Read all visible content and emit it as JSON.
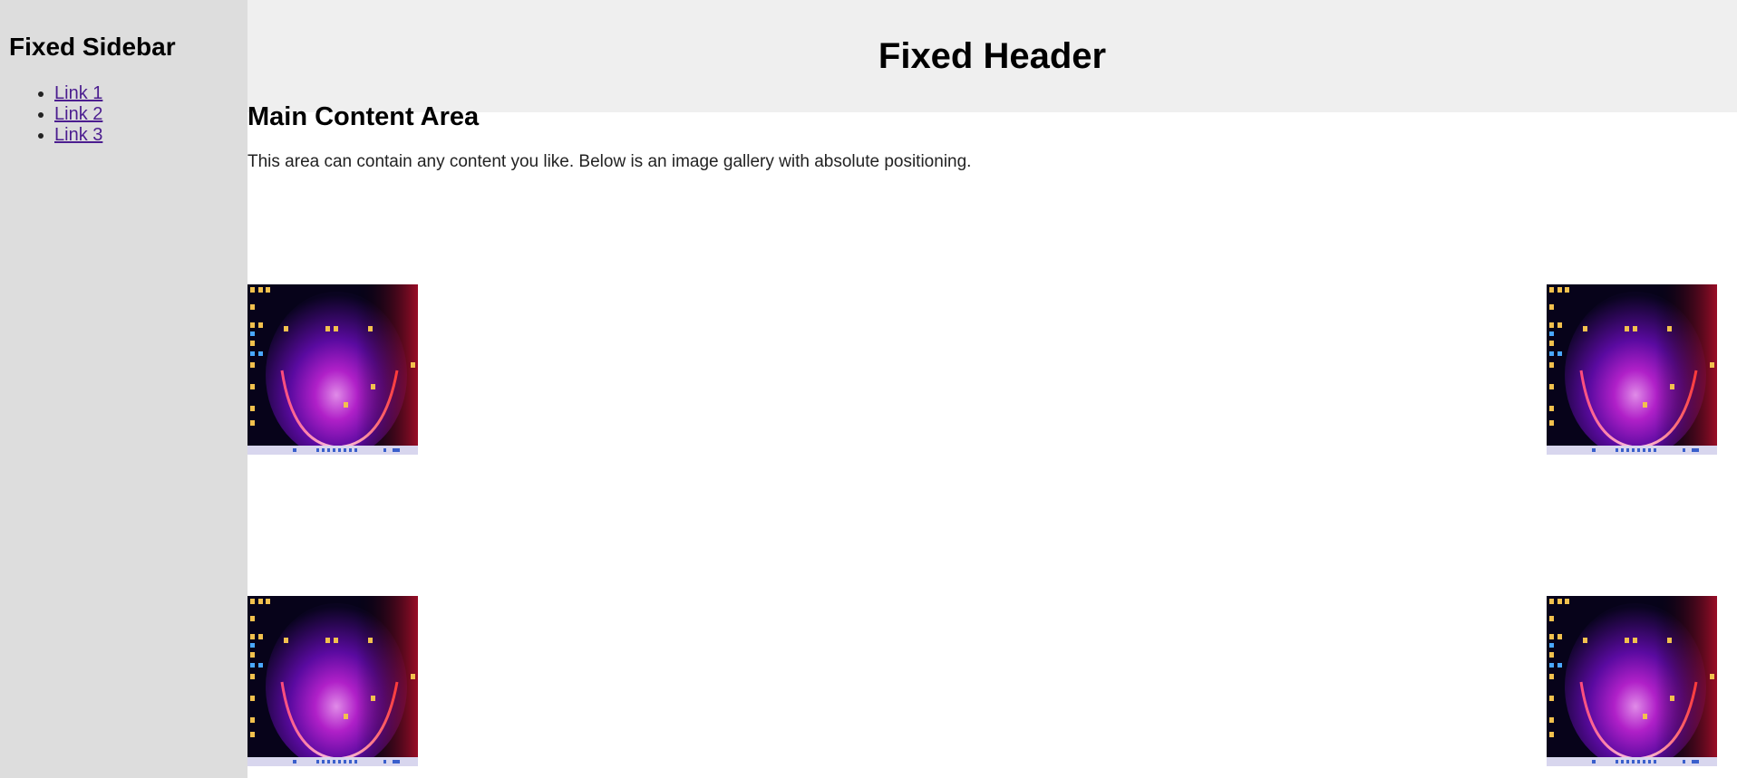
{
  "sidebar": {
    "title": "Fixed Sidebar",
    "links": [
      "Link 1",
      "Link 2",
      "Link 3"
    ]
  },
  "header": {
    "title": "Fixed Header"
  },
  "main": {
    "title": "Main Content Area",
    "description": "This area can contain any content you like. Below is an image gallery with absolute positioning."
  },
  "gallery": {
    "image_subject": "desktop-screenshot",
    "count": 4
  },
  "colors": {
    "sidebar_bg": "#dddddd",
    "header_bg": "#efefef",
    "link": "#4b1d8f"
  }
}
